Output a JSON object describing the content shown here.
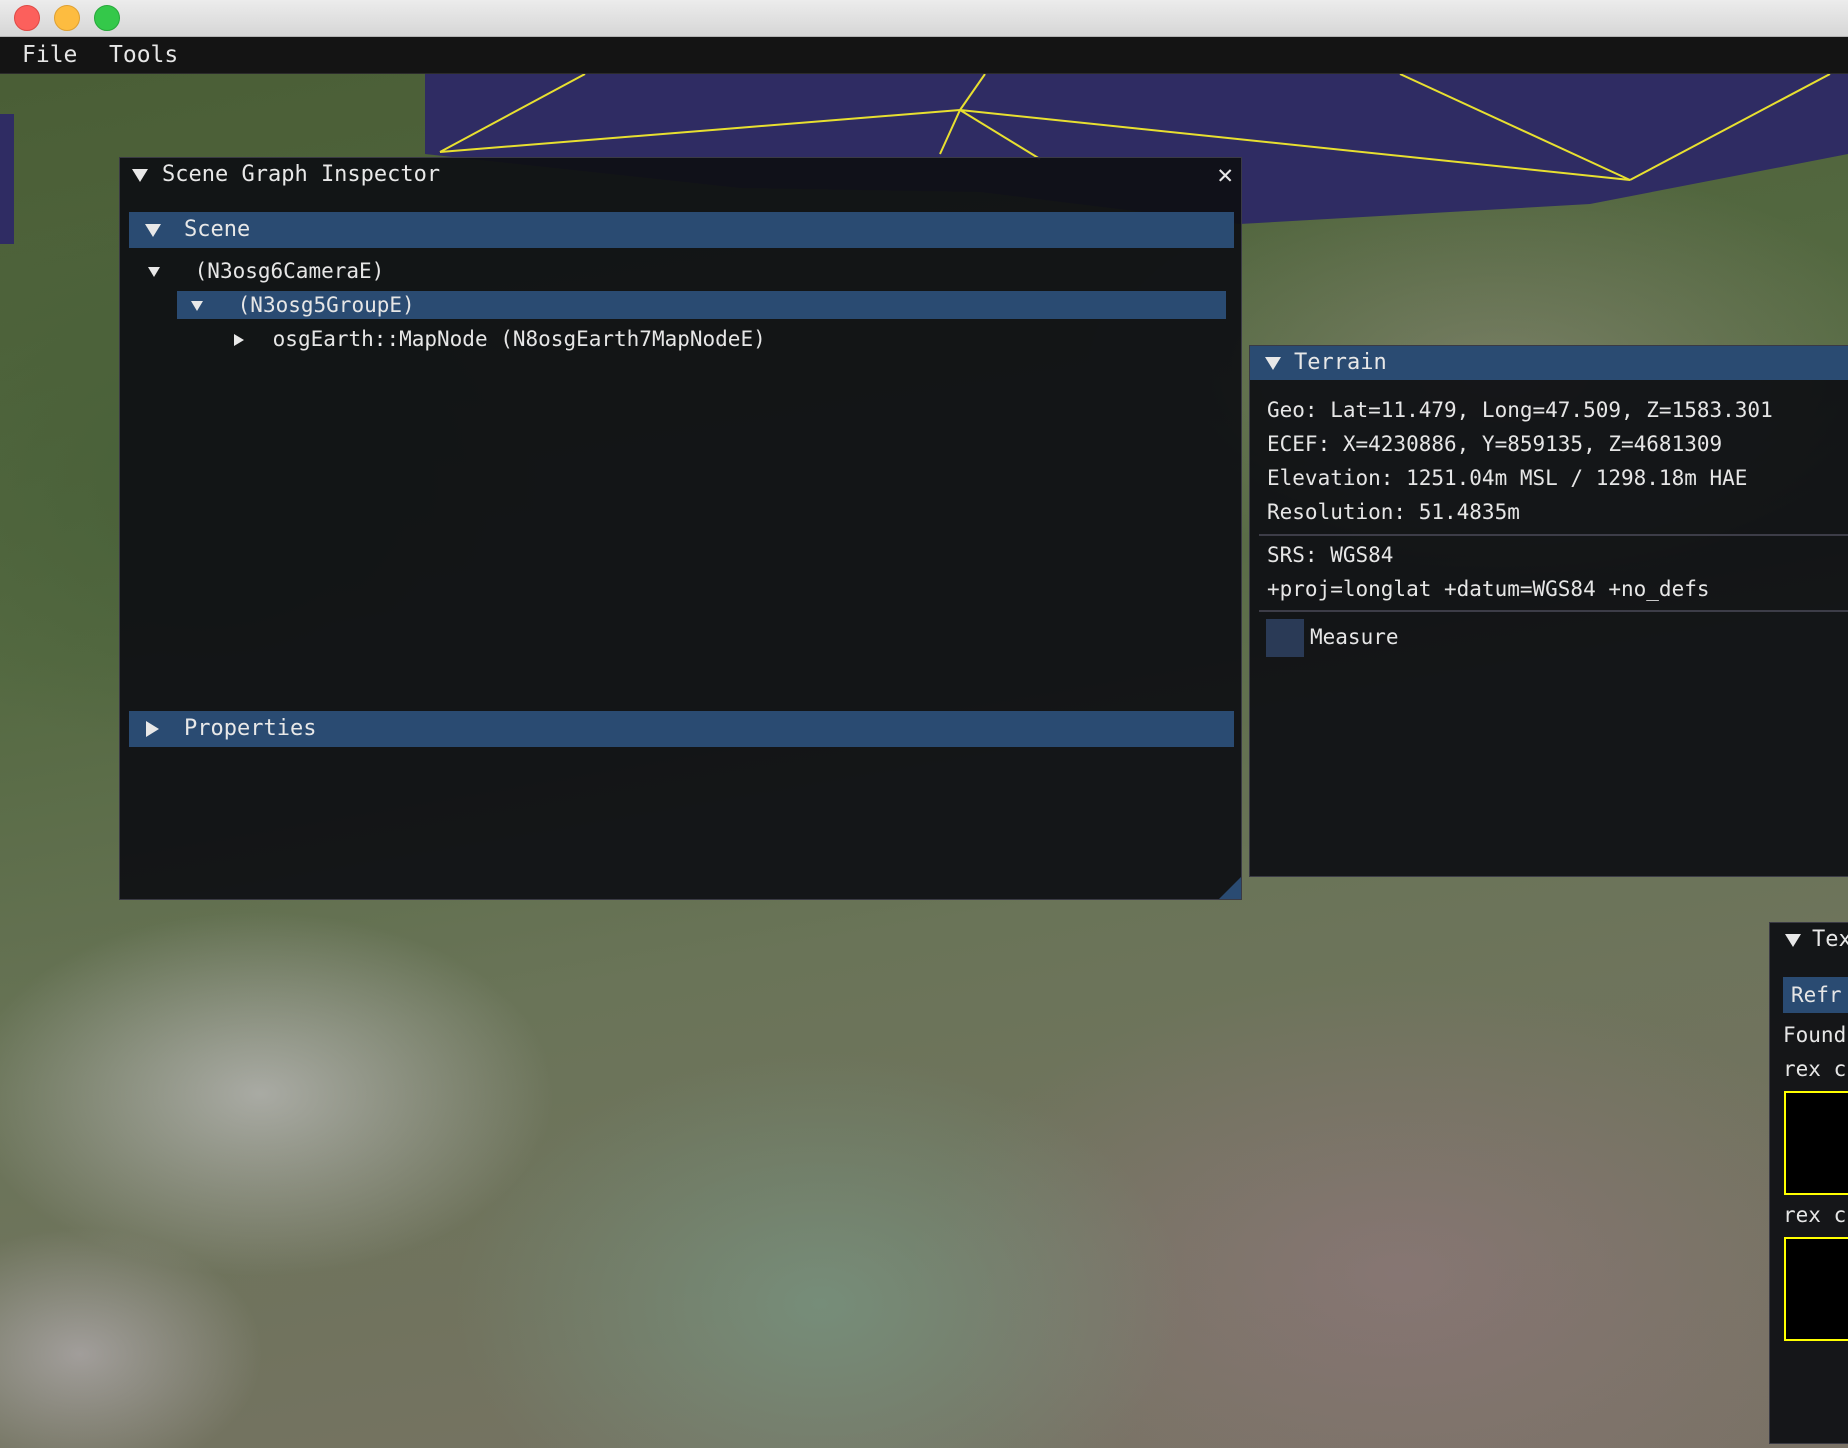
{
  "menubar": {
    "items": [
      "File",
      "Tools"
    ]
  },
  "scene_graph_inspector": {
    "title": "Scene Graph Inspector",
    "scene_header": "Scene",
    "tree": {
      "camera": "(N3osg6CameraE)",
      "group": "(N3osg5GroupE)",
      "mapnode": "osgEarth::MapNode (N8osgEarth7MapNodeE)"
    },
    "properties_header": "Properties"
  },
  "terrain": {
    "title": "Terrain",
    "geo": "Geo: Lat=11.479, Long=47.509, Z=1583.301",
    "ecef": "ECEF: X=4230886, Y=859135, Z=4681309",
    "elevation": "Elevation: 1251.04m MSL / 1298.18m HAE",
    "resolution": "Resolution: 51.4835m",
    "srs": "SRS:  WGS84",
    "proj": "+proj=longlat +datum=WGS84 +no_defs",
    "measure_label": "Measure"
  },
  "textures": {
    "title": "Tex",
    "refresh_label": "Refr",
    "found_label": "Found",
    "rex_1": "rex c",
    "rex_2": "rex c"
  },
  "colors": {
    "header": "#2a4b72",
    "window_bg": "#0f1014",
    "accent_yellow": "#ffff00",
    "sky": "#2f2c63"
  }
}
